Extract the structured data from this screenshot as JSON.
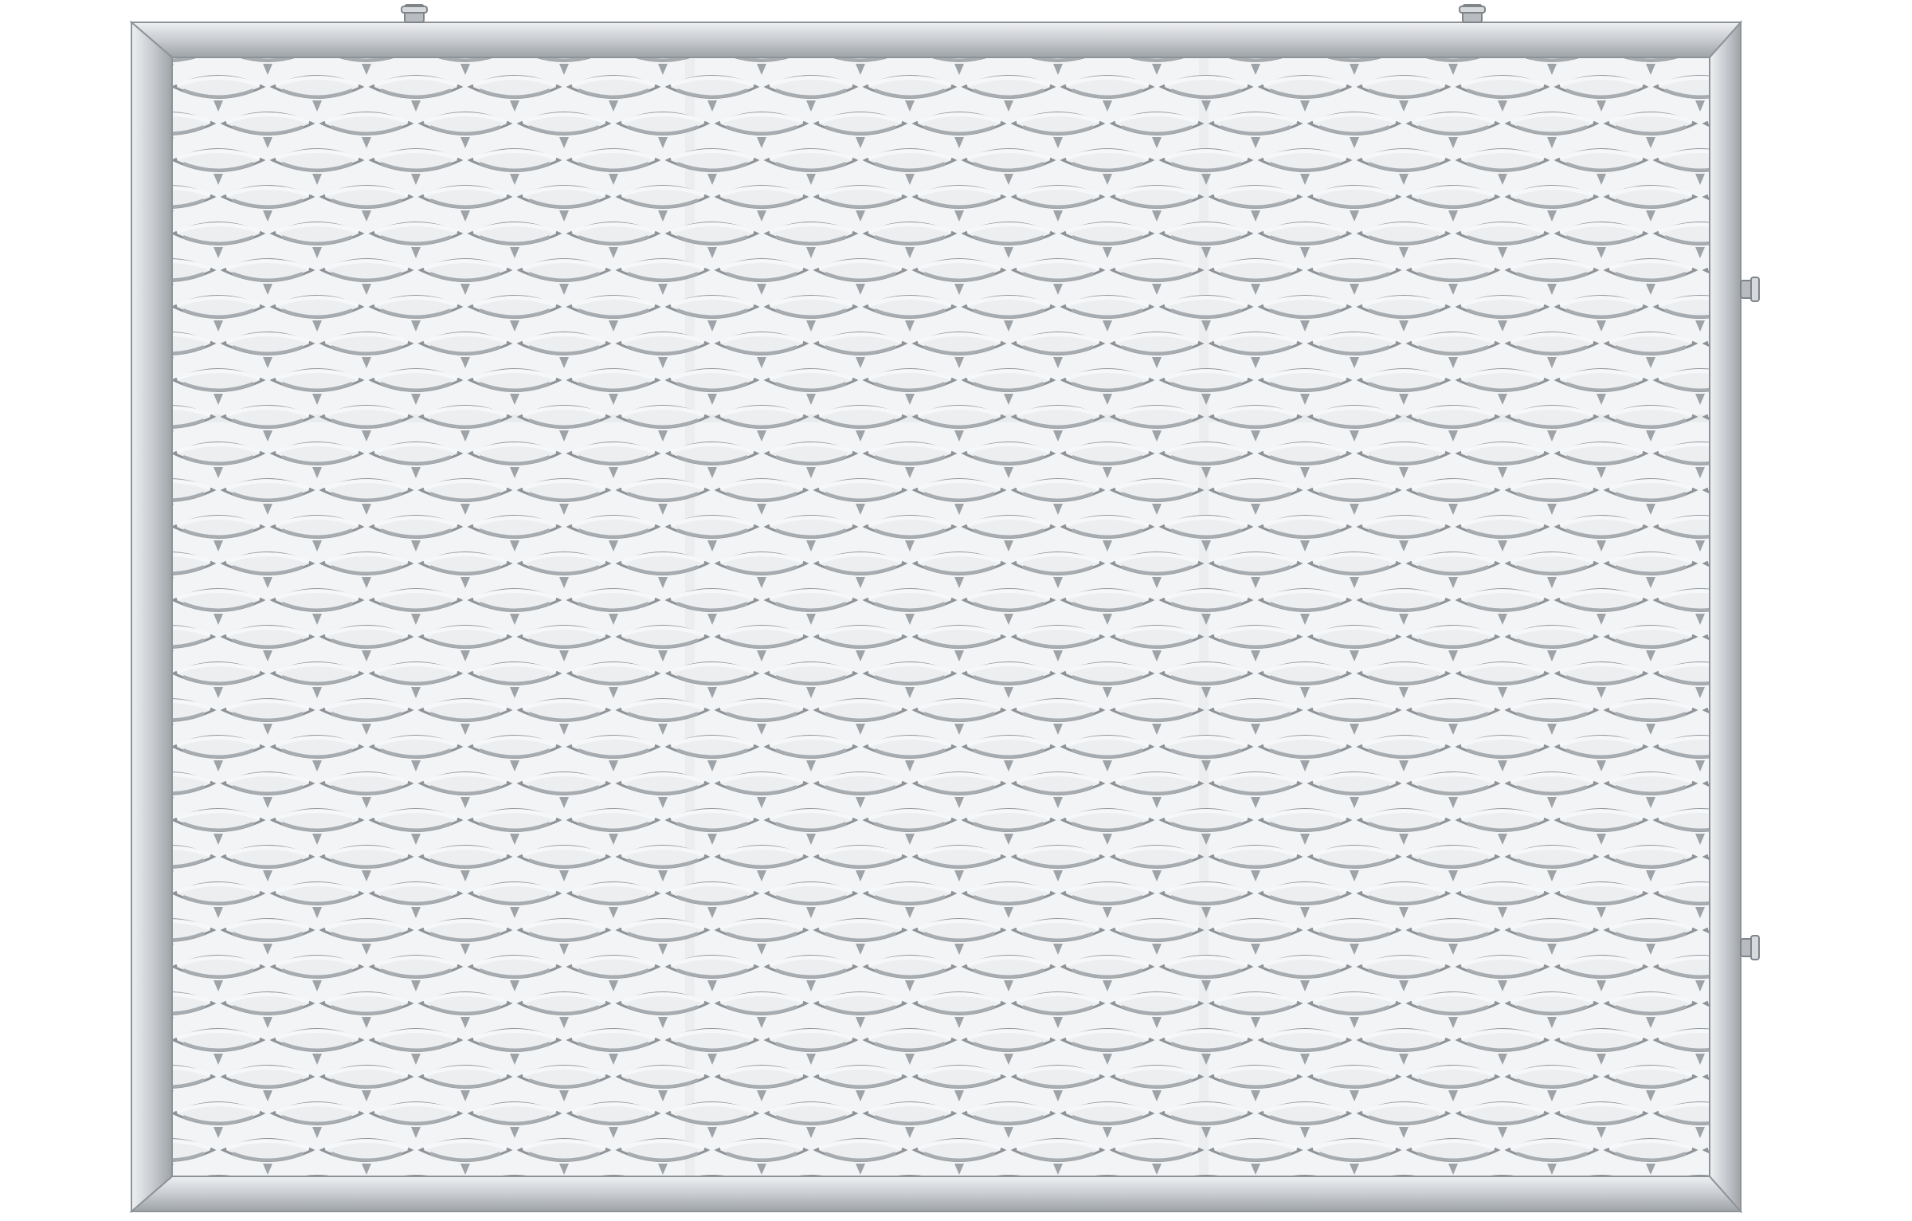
{
  "image": {
    "subject": "expanded-metal-mesh-panel",
    "background_color": "#ffffff",
    "frame_color": "#c9ccd0",
    "frame_highlight_color": "#eef0f2",
    "frame_shadow_color": "#9ea3a8",
    "mesh_color": "#d4d7da",
    "mesh_highlight_color": "#f6f7f8",
    "mesh_shadow_color": "#8e9398",
    "backing_color": "#f3f4f5",
    "fastener_color": "#b8bcc0"
  }
}
